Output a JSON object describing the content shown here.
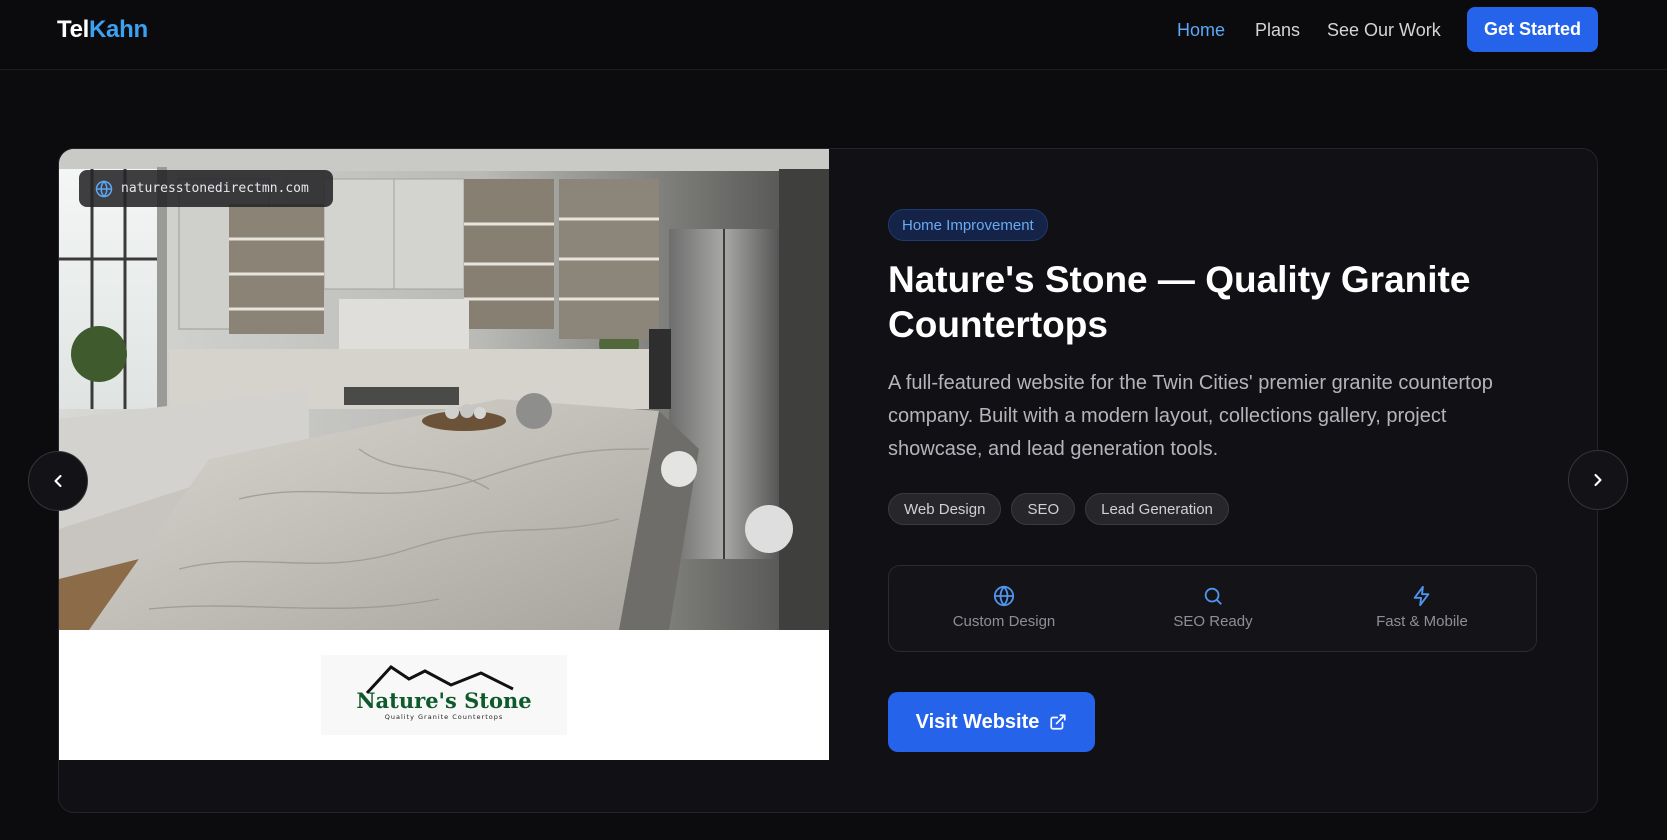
{
  "brand": {
    "part1": "Tel",
    "part2": "Kahn"
  },
  "nav": {
    "links": [
      {
        "label": "Home",
        "active": true
      },
      {
        "label": "Plans",
        "active": false
      },
      {
        "label": "See Our Work",
        "active": false
      }
    ],
    "cta": "Get Started"
  },
  "project": {
    "url": "naturesstonedirectmn.com",
    "category": "Home Improvement",
    "title": "Nature's Stone — Quality Granite Countertops",
    "description": "A full-featured website for the Twin Cities' premier granite countertop company. Built with a modern layout, collections gallery, project showcase, and lead generation tools.",
    "tags": [
      "Web Design",
      "SEO",
      "Lead Generation"
    ],
    "features": [
      {
        "icon": "globe-icon",
        "label": "Custom Design"
      },
      {
        "icon": "search-icon",
        "label": "SEO Ready"
      },
      {
        "icon": "lightning-icon",
        "label": "Fast & Mobile"
      }
    ],
    "visit_label": "Visit Website",
    "client_logo": {
      "name": "Nature's Stone",
      "tagline": "Quality Granite Countertops"
    }
  },
  "colors": {
    "accent": "#2563eb",
    "accent_text": "#5aa8f7",
    "background": "#0c0c0f",
    "card": "#111115"
  }
}
